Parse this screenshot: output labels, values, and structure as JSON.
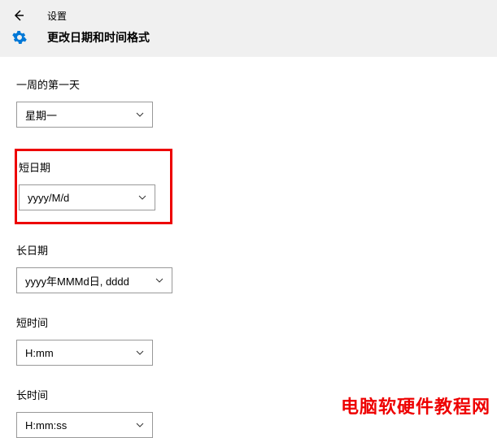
{
  "header": {
    "breadcrumb": "设置",
    "title": "更改日期和时间格式"
  },
  "fields": {
    "first_day": {
      "label": "一周的第一天",
      "value": "星期一"
    },
    "short_date": {
      "label": "短日期",
      "value": "yyyy/M/d"
    },
    "long_date": {
      "label": "长日期",
      "value": "yyyy年MMMd日, dddd"
    },
    "short_time": {
      "label": "短时间",
      "value": "H:mm"
    },
    "long_time": {
      "label": "长时间",
      "value": "H:mm:ss"
    }
  },
  "watermark": "电脑软硬件教程网"
}
